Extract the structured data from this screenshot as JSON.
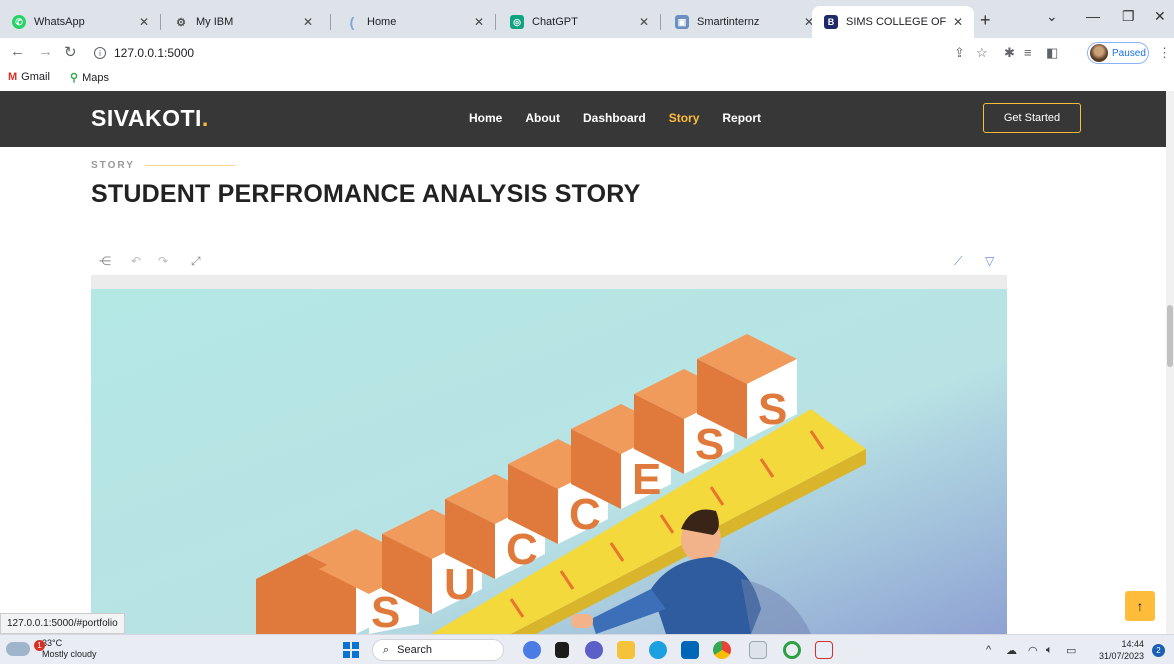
{
  "browser": {
    "tabs": [
      {
        "title": "WhatsApp",
        "icon": "whatsapp-icon",
        "color": "#25d366",
        "glyph": "✆"
      },
      {
        "title": "My IBM",
        "icon": "ibm-icon",
        "color": "#555555",
        "glyph": "⚙"
      },
      {
        "title": "Home",
        "icon": "home-icon",
        "color": "#7aa7d8",
        "glyph": "("
      },
      {
        "title": "ChatGPT",
        "icon": "chatgpt-icon",
        "color": "#10a37f",
        "glyph": "◎"
      },
      {
        "title": "Smartinternz",
        "icon": "smartinternz-icon",
        "color": "#6b8fbf",
        "glyph": "▣"
      },
      {
        "title": "SIMS COLLEGE OF LIFE SCI",
        "icon": "sims-icon",
        "color": "#1f2a6b",
        "glyph": "B"
      }
    ],
    "new_tab": "+",
    "url": "127.0.0.1:5000",
    "profile_label": "Paused",
    "bookmarks": [
      {
        "label": "Gmail",
        "icon": "gmail-icon"
      },
      {
        "label": "Maps",
        "icon": "maps-icon"
      }
    ],
    "status_url": "127.0.0.1:5000/#portfolio"
  },
  "site": {
    "logo_text": "SIVAKOTI",
    "logo_dot": ".",
    "nav": [
      {
        "label": "Home",
        "active": false
      },
      {
        "label": "About",
        "active": false
      },
      {
        "label": "Dashboard",
        "active": false
      },
      {
        "label": "Story",
        "active": true
      },
      {
        "label": "Report",
        "active": false
      }
    ],
    "cta": "Get Started",
    "accent": "#febc3b",
    "header_bg": "#373737"
  },
  "section": {
    "label": "STORY",
    "title": "STUDENT PERFROMANCE ANALYSIS STORY"
  },
  "image_text": {
    "word": "SUCCESS"
  },
  "taskbar": {
    "temperature": "33°C",
    "weather": "Mostly cloudy",
    "weather_badge": "1",
    "search_label": "Search",
    "time": "14:44",
    "date": "31/07/2023",
    "notification_count": "2"
  }
}
